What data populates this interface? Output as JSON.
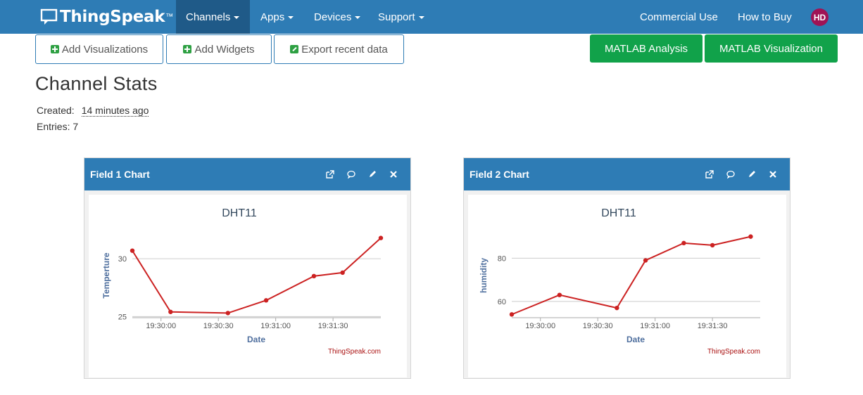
{
  "nav": {
    "brand": "ThingSpeak",
    "brand_mark": "™",
    "items": [
      {
        "label": "Channels"
      },
      {
        "label": "Apps"
      },
      {
        "label": "Devices"
      },
      {
        "label": "Support"
      }
    ],
    "right_items": [
      {
        "label": "Commercial Use"
      },
      {
        "label": "How to Buy"
      }
    ],
    "avatar": "HD"
  },
  "toolbar": {
    "add_visualizations": "Add Visualizations",
    "add_widgets": "Add Widgets",
    "export_recent": "Export recent data",
    "matlab_analysis": "MATLAB Analysis",
    "matlab_visualization": "MATLAB Visualization"
  },
  "stats": {
    "title": "Channel Stats",
    "created_label": "Created:",
    "created_value": "14 minutes ago",
    "entries_label": "Entries:",
    "entries_value": "7"
  },
  "panels": [
    {
      "title": "Field 1 Chart"
    },
    {
      "title": "Field 2 Chart"
    }
  ],
  "colors": {
    "brand_blue": "#2e7cb5",
    "matlab_green": "#11a24a",
    "series_red": "#cc2222"
  },
  "chart_data": [
    {
      "type": "line",
      "title": "DHT11",
      "xlabel": "Date",
      "ylabel": "Temperture",
      "credit": "ThingSpeak.com",
      "x": [
        "19:29:45",
        "19:30:05",
        "19:30:35",
        "19:30:55",
        "19:31:20",
        "19:31:35",
        "19:31:55"
      ],
      "values": [
        30.7,
        25.4,
        25.3,
        26.4,
        28.5,
        28.8,
        31.8
      ],
      "xticks": [
        "19:30:00",
        "19:30:30",
        "19:31:00",
        "19:31:30"
      ],
      "yticks": [
        25,
        30
      ],
      "ylim": [
        25,
        30
      ],
      "grid": true
    },
    {
      "type": "line",
      "title": "DHT11",
      "xlabel": "Date",
      "ylabel": "humidity",
      "credit": "ThingSpeak.com",
      "x": [
        "19:29:45",
        "19:30:10",
        "19:30:40",
        "19:30:55",
        "19:31:15",
        "19:31:30",
        "19:31:50"
      ],
      "values": [
        54,
        63,
        57,
        79,
        87,
        86,
        90
      ],
      "xticks": [
        "19:30:00",
        "19:30:30",
        "19:31:00",
        "19:31:30"
      ],
      "yticks": [
        60,
        80
      ],
      "ylim": [
        60,
        80
      ],
      "grid": true
    }
  ]
}
